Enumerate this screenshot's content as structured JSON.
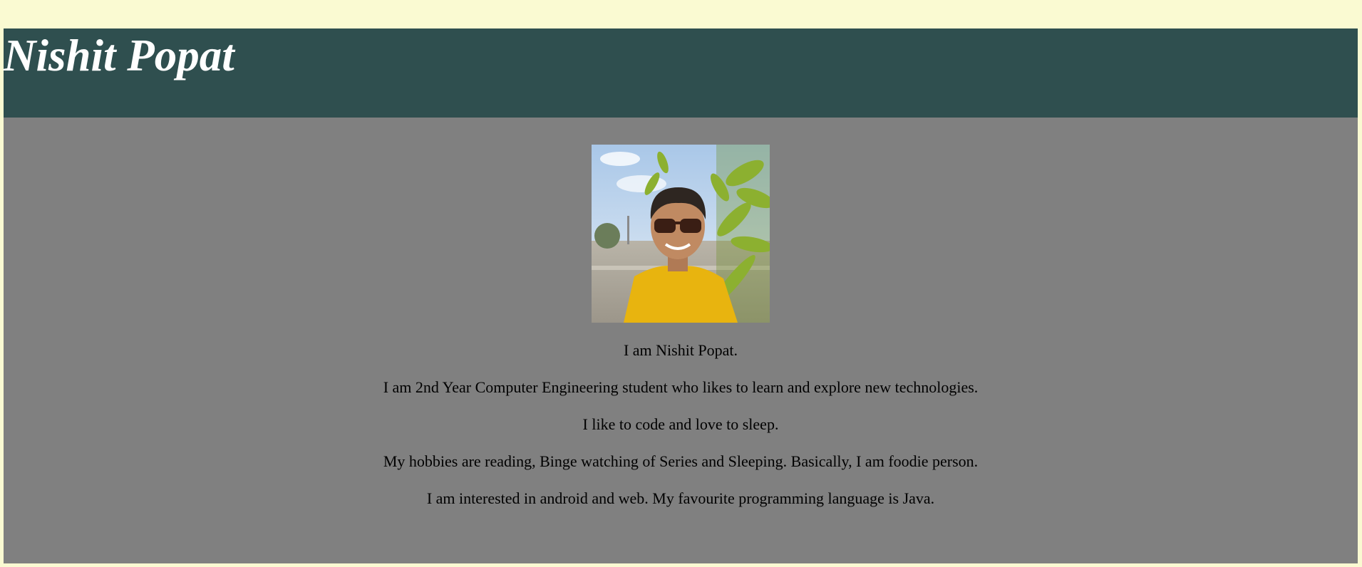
{
  "colors": {
    "page_background": "#fafad2",
    "header_background": "#2f4f4f",
    "header_text": "#ffffff",
    "content_background": "#808080",
    "content_text": "#000000"
  },
  "header": {
    "title": "Nishit Popat"
  },
  "profile": {
    "photo_icon": "profile-photo",
    "bio": [
      "I am Nishit Popat.",
      "I am 2nd Year Computer Engineering student who likes to learn and explore new technologies.",
      "I like to code and love to sleep.",
      "My hobbies are reading, Binge watching of Series and Sleeping. Basically, I am foodie person.",
      "I am interested in android and web. My favourite programming language is Java."
    ]
  }
}
